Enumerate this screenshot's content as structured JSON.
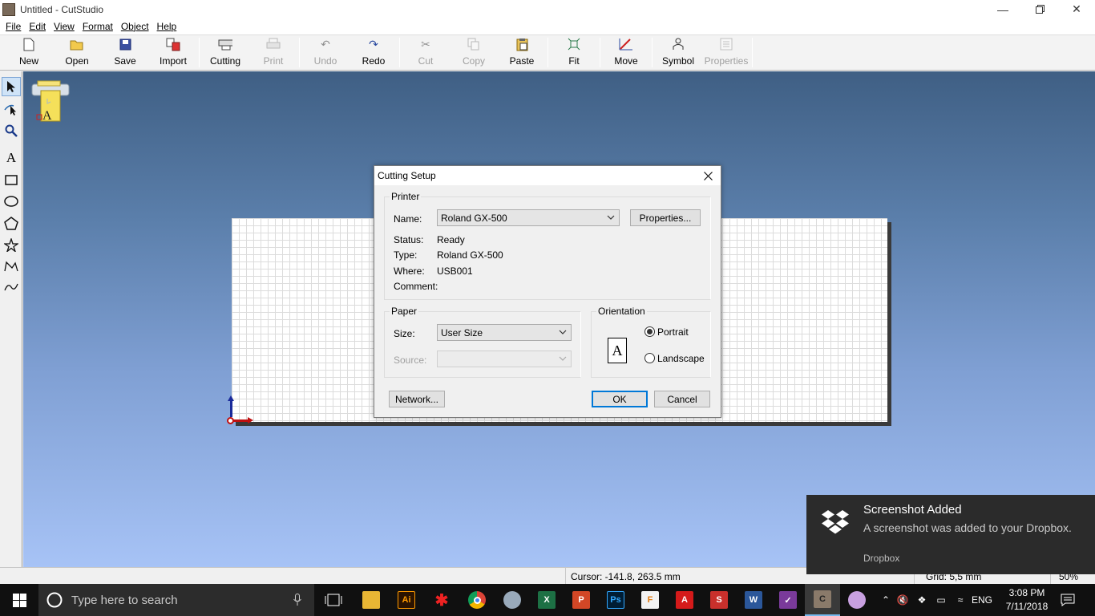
{
  "window": {
    "title": "Untitled - CutStudio"
  },
  "menu": [
    "File",
    "Edit",
    "View",
    "Format",
    "Object",
    "Help"
  ],
  "toolbar": {
    "new": "New",
    "open": "Open",
    "save": "Save",
    "import": "Import",
    "cutting": "Cutting",
    "print": "Print",
    "undo": "Undo",
    "redo": "Redo",
    "cut": "Cut",
    "copy": "Copy",
    "paste": "Paste",
    "fit": "Fit",
    "move": "Move",
    "symbol": "Symbol",
    "properties": "Properties"
  },
  "dialog": {
    "title": "Cutting Setup",
    "printer_group": "Printer",
    "name_label": "Name:",
    "name_value": "Roland GX-500",
    "properties_button": "Properties...",
    "status_label": "Status:",
    "status_value": "Ready",
    "type_label": "Type:",
    "type_value": "Roland GX-500",
    "where_label": "Where:",
    "where_value": "USB001",
    "comment_label": "Comment:",
    "comment_value": "",
    "paper_group": "Paper",
    "size_label": "Size:",
    "size_value": "User Size",
    "source_label": "Source:",
    "source_value": "",
    "orientation_group": "Orientation",
    "portrait_label": "Portrait",
    "landscape_label": "Landscape",
    "orientation_selected": "Portrait",
    "orientation_glyph": "A",
    "network_button": "Network...",
    "ok_button": "OK",
    "cancel_button": "Cancel"
  },
  "statusbar": {
    "cursor": "Cursor: -141.8, 263.5 mm",
    "grid": "Grid: 5,5 mm",
    "zoom": "50%"
  },
  "notification": {
    "title": "Screenshot Added",
    "body": "A screenshot was added to your Dropbox.",
    "source": "Dropbox"
  },
  "taskbar": {
    "search_placeholder": "Type here to search",
    "language": "ENG",
    "time": "3:08 PM",
    "date": "7/11/2018"
  },
  "colors": {
    "canvas_top": "#3f5f84",
    "canvas_bottom": "#a7c3f6",
    "default_button_border": "#0078d7",
    "toast_bg": "#2b2b2b"
  }
}
